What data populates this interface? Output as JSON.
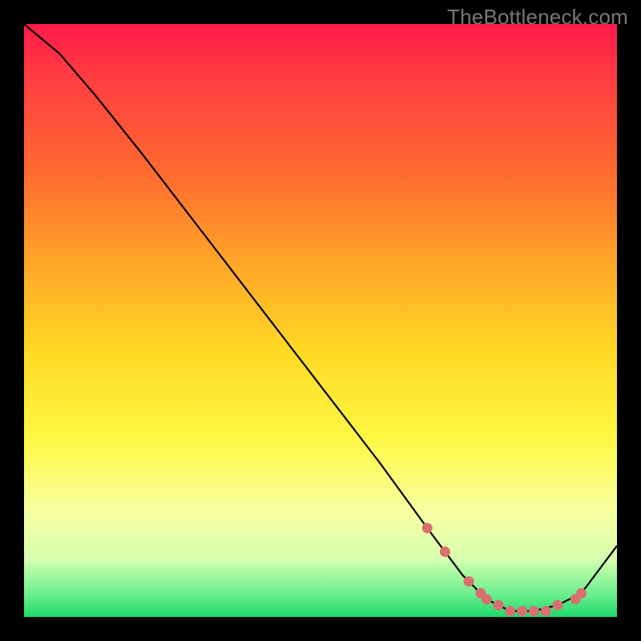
{
  "watermark": "TheBottleneck.com",
  "chart_data": {
    "type": "line",
    "title": "",
    "xlabel": "",
    "ylabel": "",
    "xlim": [
      0,
      100
    ],
    "ylim": [
      0,
      100
    ],
    "series": [
      {
        "name": "bottleneck-curve",
        "x": [
          0,
          6,
          12,
          20,
          30,
          40,
          50,
          60,
          68,
          74,
          78,
          82,
          86,
          90,
          94,
          100
        ],
        "y": [
          100,
          95,
          88,
          78,
          65,
          52,
          39,
          26,
          15,
          7,
          3,
          1,
          1,
          2,
          4,
          12
        ]
      }
    ],
    "markers": {
      "name": "highlight-dots",
      "color": "#d9706e",
      "x": [
        68,
        71,
        75,
        77,
        78,
        80,
        82,
        84,
        86,
        88,
        90,
        93,
        94
      ],
      "y": [
        15,
        11,
        6,
        4,
        3,
        2,
        1,
        1,
        1,
        1,
        2,
        3,
        4
      ]
    }
  }
}
